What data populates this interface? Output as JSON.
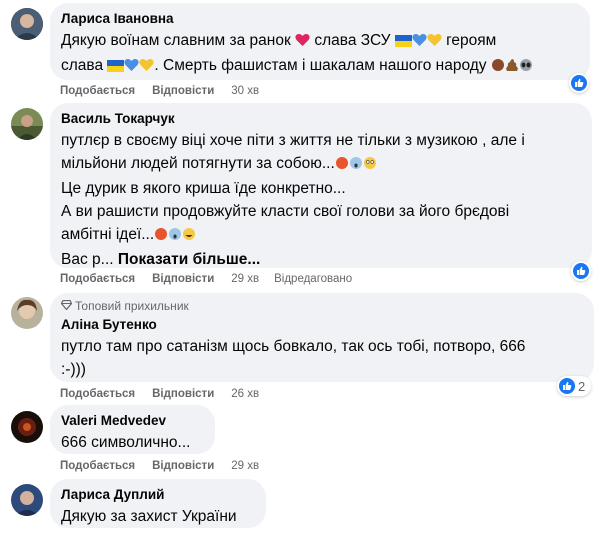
{
  "comments": [
    {
      "author": "Лариса Івановна",
      "lines": [
        "Дякую воїнам славним за ранок",
        "слава ЗСУ",
        "героям",
        "слава",
        ". Смерть фашистам і шакалам нашого народу"
      ],
      "actions": {
        "like": "Подобається",
        "reply": "Відповісти",
        "time": "30 хв"
      }
    },
    {
      "author": "Василь Токарчук",
      "lines": [
        "путлєр в своєму віці хоче піти з життя не тільки з музикою , але і",
        "мільйони людей потягнути за собою...",
        "Це дурик в якого криша їде конкретно...",
        "А ви рашисти продовжуйте класти свої голови за його брєдові",
        "амбітні ідеї...",
        "Вас р...",
        "Показати більше..."
      ],
      "actions": {
        "like": "Подобається",
        "reply": "Відповісти",
        "time": "29 хв",
        "edited": "Відредаговано"
      }
    },
    {
      "badge": "Топовий прихильник",
      "author": "Аліна Бутенко",
      "lines": [
        "путло там про сатанізм щось бовкало, так ось тобі, потворо, 666",
        ":-)))"
      ],
      "reaction_count": "2",
      "actions": {
        "like": "Подобається",
        "reply": "Відповісти",
        "time": "26 хв"
      }
    },
    {
      "author": "Valeri Medvedev",
      "lines": [
        "666 символично..."
      ],
      "actions": {
        "like": "Подобається",
        "reply": "Відповісти",
        "time": "29 хв"
      }
    },
    {
      "author": "Лариса Дуплий",
      "lines": [
        "Дякую за захист України"
      ]
    }
  ],
  "icons": {
    "reaction": "like-icon",
    "badge": "diamond-icon"
  },
  "colors": {
    "bubble": "#f0f2f5",
    "meta": "#65676b",
    "like": "#1877f2"
  }
}
